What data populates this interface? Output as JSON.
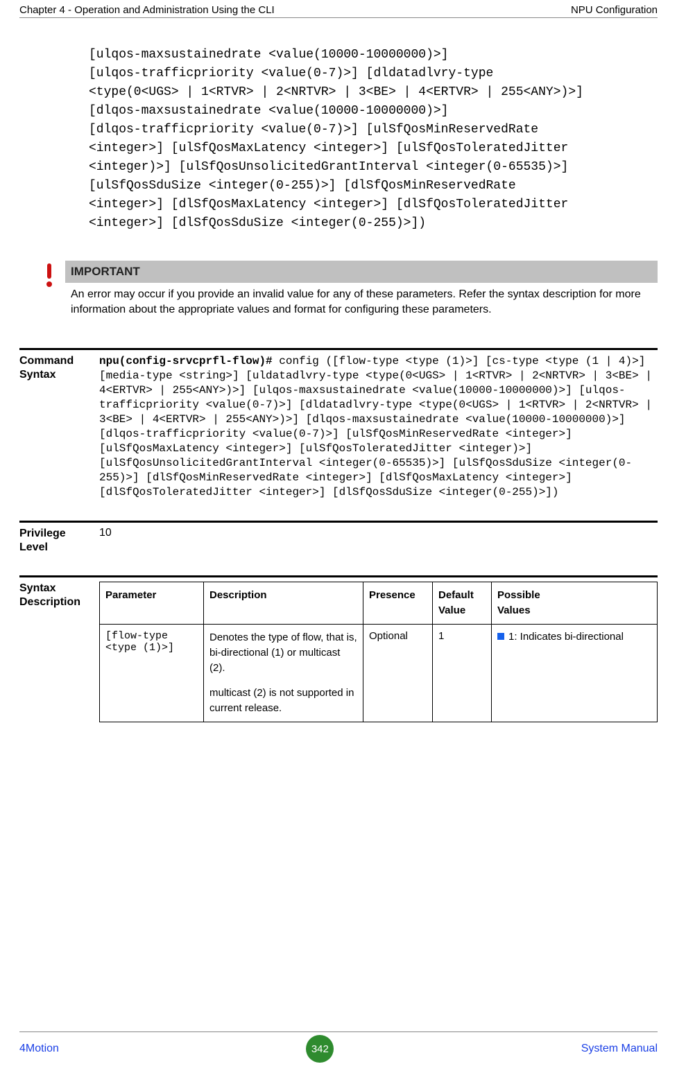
{
  "header": {
    "left": "Chapter 4 - Operation and Administration Using the CLI",
    "right": "NPU Configuration"
  },
  "code_block": "[ulqos-maxsustainedrate <value(10000-10000000)>] \n[ulqos-trafficpriority <value(0-7)>] [dldatadlvry-type \n<type(0<UGS> | 1<RTVR> | 2<NRTVR> | 3<BE> | 4<ERTVR> | 255<ANY>)>] \n[dlqos-maxsustainedrate <value(10000-10000000)>] \n[dlqos-trafficpriority <value(0-7)>] [ulSfQosMinReservedRate \n<integer>] [ulSfQosMaxLatency <integer>] [ulSfQosToleratedJitter \n<integer)>] [ulSfQosUnsolicitedGrantInterval <integer(0-65535)>] \n[ulSfQosSduSize <integer(0-255)>] [dlSfQosMinReservedRate \n<integer>] [dlSfQosMaxLatency <integer>] [dlSfQosToleratedJitter \n<integer>] [dlSfQosSduSize <integer(0-255)>])",
  "important": {
    "title": "IMPORTANT",
    "body": "An error may occur if you provide an invalid value for any of these parameters. Refer the syntax description for more information about the appropriate values and format for configuring these parameters."
  },
  "command_syntax": {
    "label_line1": "Command",
    "label_line2": "Syntax",
    "prompt": "npu(config-srvcprfl-flow)#",
    "rest": " config ([flow-type <type (1)>] [cs-type <type (1 | 4)>] [media-type <string>] [uldatadlvry-type <type(0<UGS> | 1<RTVR> | 2<NRTVR> | 3<BE> | 4<ERTVR> | 255<ANY>)>] [ulqos-maxsustainedrate <value(10000-10000000)>] [ulqos-trafficpriority <value(0-7)>] [dldatadlvry-type <type(0<UGS> | 1<RTVR> | 2<NRTVR> | 3<BE> | 4<ERTVR> | 255<ANY>)>] [dlqos-maxsustainedrate <value(10000-10000000)>] [dlqos-trafficpriority <value(0-7)>] [ulSfQosMinReservedRate <integer>] [ulSfQosMaxLatency <integer>] [ulSfQosToleratedJitter <integer)>] [ulSfQosUnsolicitedGrantInterval <integer(0-65535)>] [ulSfQosSduSize <integer(0-255)>] [dlSfQosMinReservedRate <integer>] [dlSfQosMaxLatency <integer>] [dlSfQosToleratedJitter <integer>] [dlSfQosSduSize <integer(0-255)>])"
  },
  "privilege": {
    "label_line1": "Privilege",
    "label_line2": "Level",
    "value": "10"
  },
  "syntax_desc": {
    "label_line1": "Syntax",
    "label_line2": "Description",
    "headers": {
      "param": "Parameter",
      "desc": "Description",
      "presence": "Presence",
      "default_line1": "Default",
      "default_line2": "Value",
      "possible_line1": "Possible",
      "possible_line2": "Values"
    },
    "rows": [
      {
        "param": "[flow-type <type (1)>]",
        "desc_p1": "Denotes the type of flow, that is, bi-directional (1) or multicast (2).",
        "desc_p2": "multicast (2) is not supported in current release.",
        "presence": "Optional",
        "default": "1",
        "possible": "1: Indicates bi-directional"
      }
    ]
  },
  "footer": {
    "left": "4Motion",
    "page": "342",
    "right": "System Manual"
  }
}
